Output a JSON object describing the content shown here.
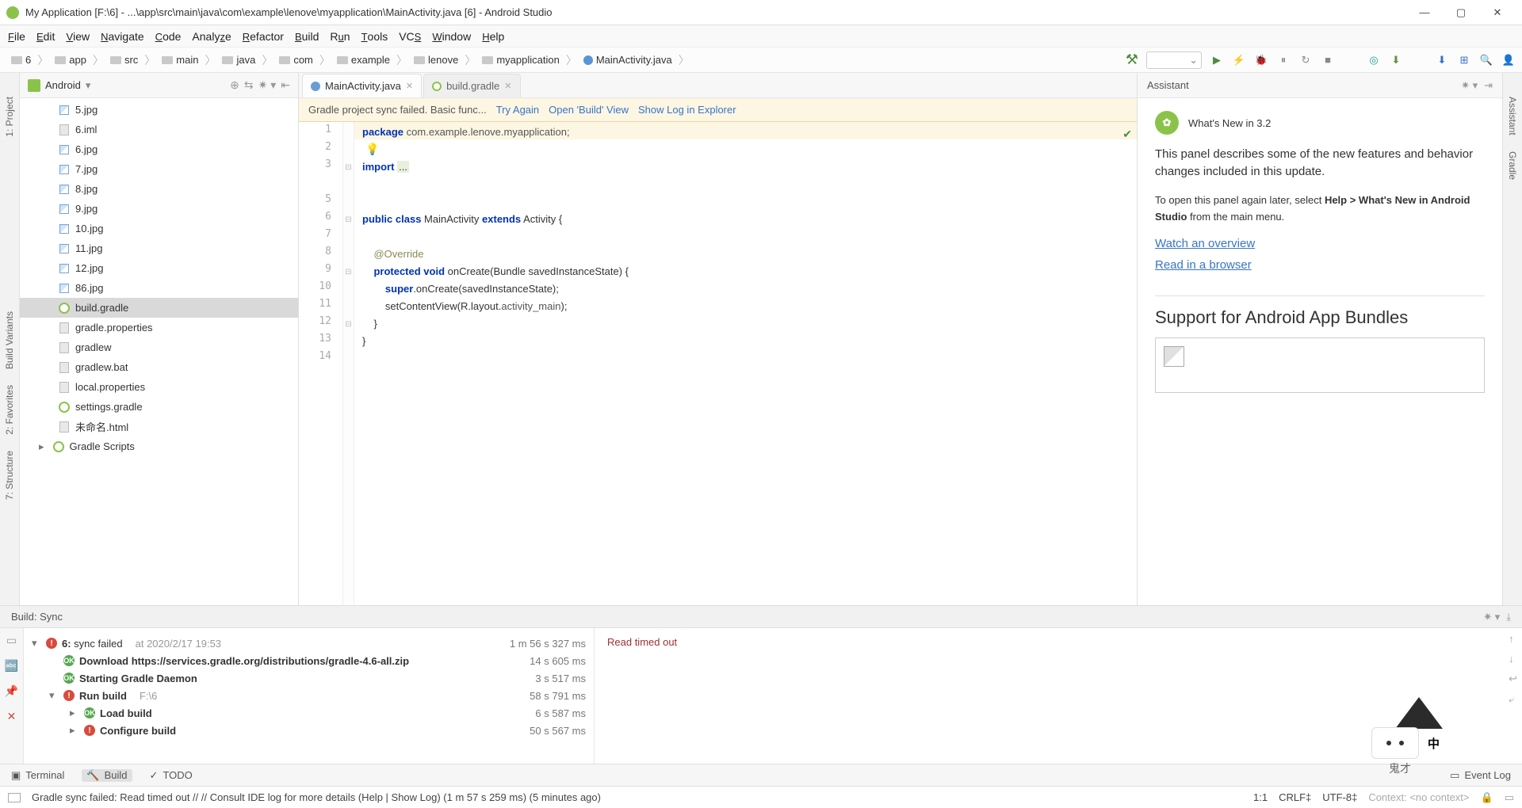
{
  "window": {
    "title": "My Application [F:\\6] - ...\\app\\src\\main\\java\\com\\example\\lenove\\myapplication\\MainActivity.java [6] - Android Studio"
  },
  "menu": [
    "File",
    "Edit",
    "View",
    "Navigate",
    "Code",
    "Analyze",
    "Refactor",
    "Build",
    "Run",
    "Tools",
    "VCS",
    "Window",
    "Help"
  ],
  "breadcrumbs": [
    "6",
    "app",
    "src",
    "main",
    "java",
    "com",
    "example",
    "lenove",
    "myapplication",
    "MainActivity.java"
  ],
  "project": {
    "header": "Android",
    "files": [
      "5.jpg",
      "6.iml",
      "6.jpg",
      "7.jpg",
      "8.jpg",
      "9.jpg",
      "10.jpg",
      "11.jpg",
      "12.jpg",
      "86.jpg",
      "build.gradle",
      "gradle.properties",
      "gradlew",
      "gradlew.bat",
      "local.properties",
      "settings.gradle",
      "未命名.html"
    ],
    "selected": "build.gradle",
    "scripts": "Gradle Scripts"
  },
  "tabs": [
    {
      "name": "MainActivity.java",
      "active": true
    },
    {
      "name": "build.gradle",
      "active": false
    }
  ],
  "notif": {
    "msg": "Gradle project sync failed. Basic func...",
    "links": [
      "Try Again",
      "Open 'Build' View",
      "Show Log in Explorer"
    ]
  },
  "code": {
    "lines": [
      "1",
      "2",
      "3",
      "",
      "5",
      "6",
      "7",
      "8",
      "9",
      "10",
      "11",
      "12",
      "13",
      "14"
    ]
  },
  "assistant": {
    "header": "Assistant",
    "h1": "What's New in 3.2",
    "p1": "This panel describes some of the new features and behavior changes included in this update.",
    "p2a": "To open this panel again later, select ",
    "p2b": "Help > What's New in Android Studio",
    "p2c": " from the main menu.",
    "link1": "Watch an overview",
    "link2": "Read in a browser",
    "h2": "Support for Android App Bundles"
  },
  "build": {
    "header": "Build: Sync",
    "rows": [
      {
        "lvl": 0,
        "chev": "▾",
        "icon": "err",
        "text": "6: sync failed",
        "ts": "at 2020/2/17 19:53",
        "time": "1 m 56 s 327 ms"
      },
      {
        "lvl": 1,
        "icon": "ok",
        "text": "Download https://services.gradle.org/distributions/gradle-4.6-all.zip",
        "time": "14 s 605 ms"
      },
      {
        "lvl": 1,
        "icon": "ok",
        "text": "Starting Gradle Daemon",
        "time": "3 s 517 ms"
      },
      {
        "lvl": 1,
        "chev": "▾",
        "icon": "err",
        "text": "Run build",
        "ts": "F:\\6",
        "time": "58 s 791 ms"
      },
      {
        "lvl": 2,
        "chev": "▸",
        "icon": "ok",
        "text": "Load build",
        "time": "6 s 587 ms"
      },
      {
        "lvl": 2,
        "chev": "▸",
        "icon": "err",
        "text": "Configure build",
        "time": "50 s 567 ms"
      }
    ],
    "log": "Read timed out"
  },
  "bottombar": {
    "terminal": "Terminal",
    "build": "Build",
    "todo": "TODO",
    "eventlog": "Event Log"
  },
  "statusbar": {
    "msg": "Gradle sync failed: Read timed out // // Consult IDE log for more details (Help | Show Log) (1 m 57 s 259 ms) (5 minutes ago)",
    "pos": "1:1",
    "sep": "CRLF‡",
    "enc": "UTF-8‡",
    "ctx": "Context: <no context>"
  },
  "leftstripe": [
    "1: Project",
    "Build Variants",
    "2: Favorites",
    "7: Structure"
  ],
  "rightstripe": [
    "Assistant",
    "Gradle"
  ],
  "mascot": {
    "label": "鬼才",
    "cn": "中"
  }
}
